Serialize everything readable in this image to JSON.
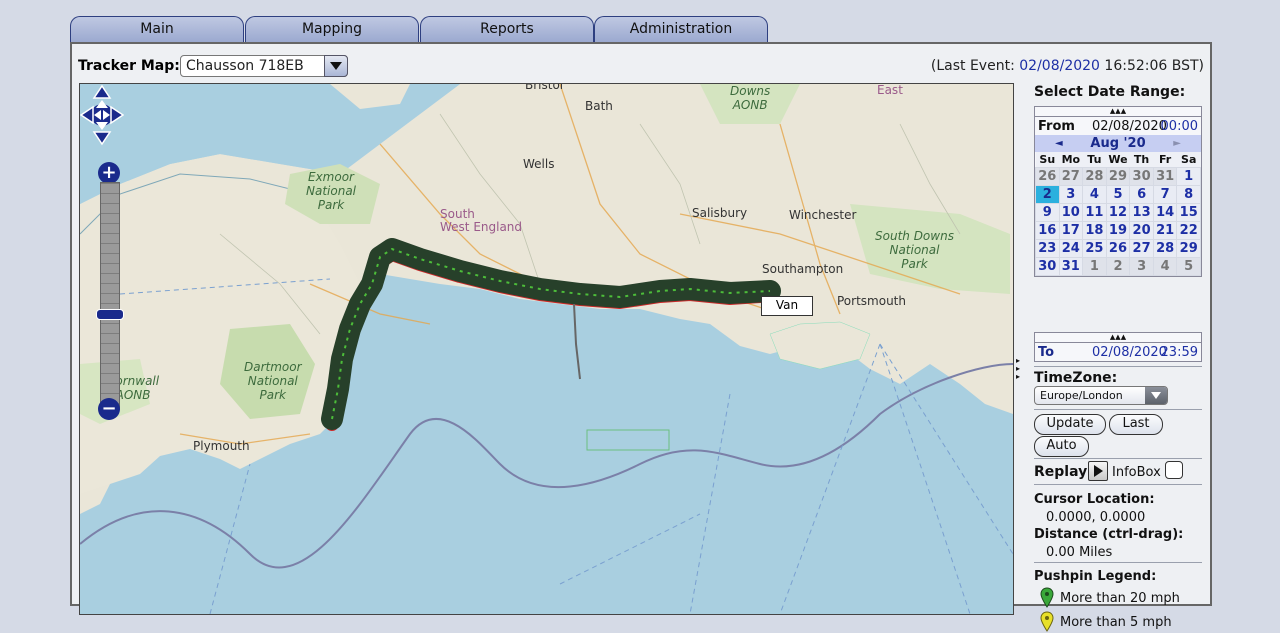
{
  "tabs": [
    "Main",
    "Mapping",
    "Reports",
    "Administration"
  ],
  "tracker": {
    "label": "Tracker Map:",
    "selected": "Chausson 718EB"
  },
  "last_event": {
    "prefix": "(Last Event:",
    "date": "02/08/2020",
    "time": "16:52:06 BST)"
  },
  "map": {
    "labels": {
      "bristol": "Bristol",
      "bath": "Bath",
      "wells": "Wells",
      "salisbury": "Salisbury",
      "winchester": "Winchester",
      "southampton": "Southampton",
      "portsmouth": "Portsmouth",
      "plymouth": "Plymouth",
      "exmoor": "Exmoor\nNational\nPark",
      "dartmoor": "Dartmoor\nNational\nPark",
      "south_downs": "South Downs\nNational\nPark",
      "north_wessex": "Downs\nAONB",
      "south_west_england": "South\nWest England",
      "cornwall": "Cornwall\nAONB",
      "east": "East"
    },
    "marker_label": "Van"
  },
  "sidebar": {
    "date_range_title": "Select Date Range:",
    "from_label": "From",
    "from_date": "02/08/2020",
    "from_time": "00:00",
    "month": "Aug '20",
    "prev": "◄",
    "next": "►",
    "weekdays": [
      "Su",
      "Mo",
      "Tu",
      "We",
      "Th",
      "Fr",
      "Sa"
    ],
    "weeks": [
      [
        "26",
        "27",
        "28",
        "29",
        "30",
        "31",
        "1"
      ],
      [
        "2",
        "3",
        "4",
        "5",
        "6",
        "7",
        "8"
      ],
      [
        "9",
        "10",
        "11",
        "12",
        "13",
        "14",
        "15"
      ],
      [
        "16",
        "17",
        "18",
        "19",
        "20",
        "21",
        "22"
      ],
      [
        "23",
        "24",
        "25",
        "26",
        "27",
        "28",
        "29"
      ],
      [
        "30",
        "31",
        "1",
        "2",
        "3",
        "4",
        "5"
      ]
    ],
    "to_label": "To",
    "to_date": "02/08/2020",
    "to_time": "23:59",
    "timezone_label": "TimeZone:",
    "timezone": "Europe/London",
    "update_label": "Update",
    "last_label": "Last",
    "auto_label": "Auto",
    "replay_label": "Replay",
    "infobox_label": "InfoBox",
    "cursor_label": "Cursor Location:",
    "cursor_value": "0.0000, 0.0000",
    "distance_label": "Distance (ctrl-drag):",
    "distance_value": "0.00 Miles",
    "legend_title": "Pushpin Legend:",
    "legend": [
      {
        "label": "More than 20 mph",
        "color": "#3aa83a"
      },
      {
        "label": "More than 5 mph",
        "color": "#e8e02a"
      }
    ]
  }
}
